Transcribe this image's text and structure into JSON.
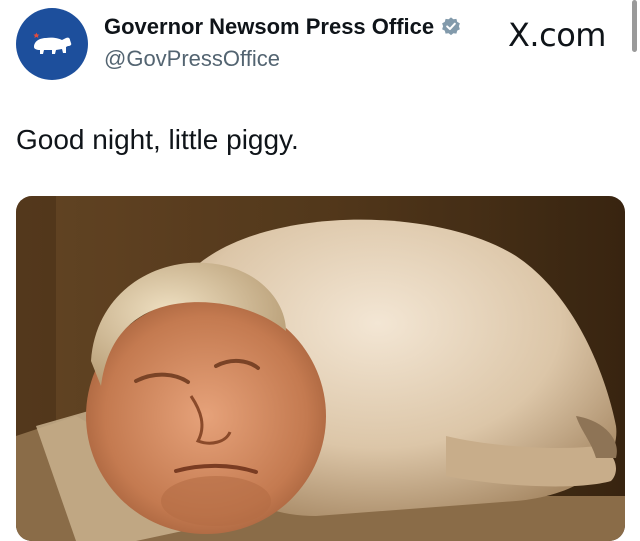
{
  "account": {
    "display_name": "Governor Newsom Press Office",
    "handle": "@GovPressOffice",
    "avatar_icon": "california-bear-icon",
    "verified_icon": "verified-badge-icon",
    "brand_color": "#1d4f9c"
  },
  "source": {
    "label": "X.com"
  },
  "tweet": {
    "text": "Good night, little piggy."
  },
  "media": {
    "image_icon": "sleeping-pig-photo"
  }
}
